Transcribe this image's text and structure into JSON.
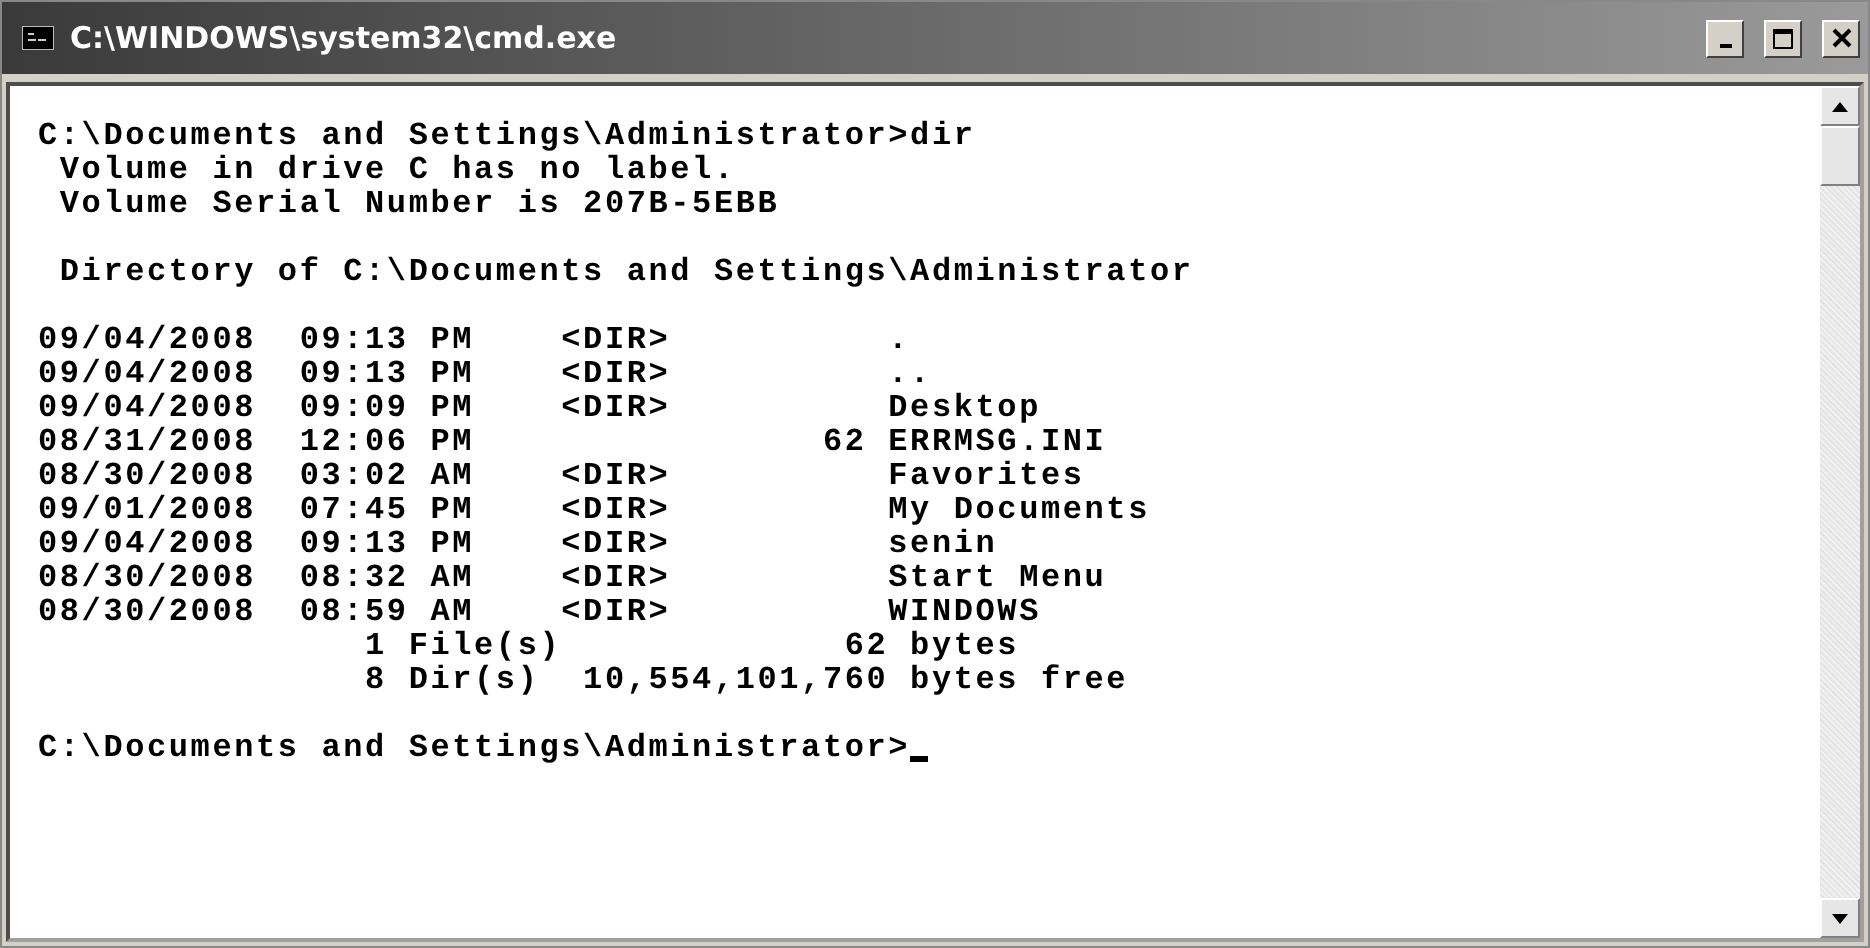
{
  "window": {
    "title": "C:\\WINDOWS\\system32\\cmd.exe"
  },
  "console": {
    "cursor": true,
    "blocks": [
      [
        "C:\\Documents and Settings\\Administrator>dir",
        " Volume in drive C has no label.",
        " Volume Serial Number is 207B-5EBB"
      ],
      [
        " Directory of C:\\Documents and Settings\\Administrator"
      ],
      [
        "09/04/2008  09:13 PM    <DIR>          .",
        "09/04/2008  09:13 PM    <DIR>          ..",
        "09/04/2008  09:09 PM    <DIR>          Desktop",
        "08/31/2008  12:06 PM                62 ERRMSG.INI",
        "08/30/2008  03:02 AM    <DIR>          Favorites",
        "09/01/2008  07:45 PM    <DIR>          My Documents",
        "09/04/2008  09:13 PM    <DIR>          senin",
        "08/30/2008  08:32 AM    <DIR>          Start Menu",
        "08/30/2008  08:59 AM    <DIR>          WINDOWS",
        "               1 File(s)             62 bytes",
        "               8 Dir(s)  10,554,101,760 bytes free"
      ],
      [
        "C:\\Documents and Settings\\Administrator>"
      ]
    ]
  }
}
